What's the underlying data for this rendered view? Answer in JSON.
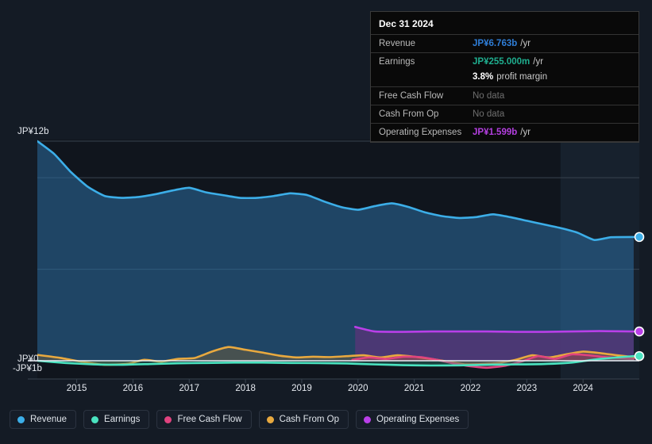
{
  "background_color": "#141b25",
  "tooltip": {
    "title": "Dec 31 2024",
    "rows": [
      {
        "label": "Revenue",
        "value": "JP¥6.763b",
        "unit": "/yr",
        "color": "#2f7ed8",
        "nodata": false
      },
      {
        "label": "Earnings",
        "value": "JP¥255.000m",
        "unit": "/yr",
        "color": "#1fae8f",
        "nodata": false
      },
      {
        "label": "",
        "value": "3.8%",
        "unit": "profit margin",
        "color": "#ffffff",
        "nodata": false,
        "sub": true
      },
      {
        "label": "Free Cash Flow",
        "value": "No data",
        "unit": "",
        "color": "#6f6f6f",
        "nodata": true
      },
      {
        "label": "Cash From Op",
        "value": "No data",
        "unit": "",
        "color": "#6f6f6f",
        "nodata": true
      },
      {
        "label": "Operating Expenses",
        "value": "JP¥1.599b",
        "unit": "/yr",
        "color": "#b43fe0",
        "nodata": false
      }
    ]
  },
  "legend": {
    "items": [
      {
        "label": "Revenue",
        "color": "#3caee8"
      },
      {
        "label": "Earnings",
        "color": "#4ae3c0"
      },
      {
        "label": "Free Cash Flow",
        "color": "#e0437f"
      },
      {
        "label": "Cash From Op",
        "color": "#e8a93f"
      },
      {
        "label": "Operating Expenses",
        "color": "#b93fe8"
      }
    ]
  },
  "chart_data": {
    "type": "area",
    "title": "",
    "xlabel": "",
    "ylabel": "",
    "currency": "JP¥",
    "grid": true,
    "legend_position": "bottom-left",
    "ylim": [
      -1,
      12
    ],
    "y_ticks": [
      {
        "value": 12,
        "label": "JP¥12b"
      },
      {
        "value": 0,
        "label": "JP¥0"
      },
      {
        "value": -1,
        "label": "-JP¥1b"
      }
    ],
    "x_ticks": [
      "2015",
      "2016",
      "2017",
      "2018",
      "2019",
      "2020",
      "2021",
      "2022",
      "2023",
      "2024"
    ],
    "xlim": [
      "2014.3",
      "2025.0"
    ],
    "forecast_band_start": "2023.6",
    "series": [
      {
        "name": "Revenue",
        "color": "#3caee8",
        "fill": "rgba(44,110,160,0.55)",
        "x": [
          2014.3,
          2014.6,
          2014.9,
          2015.2,
          2015.5,
          2015.8,
          2016.1,
          2016.4,
          2016.7,
          2017.0,
          2017.3,
          2017.6,
          2017.9,
          2018.2,
          2018.5,
          2018.8,
          2019.1,
          2019.4,
          2019.7,
          2020.0,
          2020.3,
          2020.6,
          2020.9,
          2021.2,
          2021.5,
          2021.8,
          2022.1,
          2022.4,
          2022.7,
          2023.0,
          2023.3,
          2023.6,
          2023.9,
          2024.2,
          2024.5,
          2024.9
        ],
        "values": [
          12.0,
          11.3,
          10.3,
          9.5,
          9.0,
          8.9,
          8.95,
          9.1,
          9.3,
          9.45,
          9.2,
          9.05,
          8.9,
          8.9,
          9.0,
          9.15,
          9.05,
          8.7,
          8.4,
          8.25,
          8.45,
          8.6,
          8.4,
          8.1,
          7.9,
          7.8,
          7.85,
          8.0,
          7.85,
          7.65,
          7.45,
          7.25,
          7.0,
          6.6,
          6.75,
          6.763
        ]
      },
      {
        "name": "Earnings",
        "color": "#4ae3c0",
        "fill": "rgba(50,150,130,0.35)",
        "x": [
          2014.3,
          2014.8,
          2015.3,
          2015.8,
          2016.3,
          2016.8,
          2017.3,
          2017.8,
          2018.3,
          2018.8,
          2019.3,
          2019.8,
          2020.3,
          2020.8,
          2021.3,
          2021.8,
          2022.3,
          2022.8,
          2023.3,
          2023.8,
          2024.3,
          2024.9
        ],
        "values": [
          0.0,
          -0.12,
          -0.2,
          -0.22,
          -0.18,
          -0.14,
          -0.12,
          -0.1,
          -0.1,
          -0.12,
          -0.13,
          -0.15,
          -0.2,
          -0.24,
          -0.26,
          -0.25,
          -0.22,
          -0.2,
          -0.18,
          -0.1,
          0.1,
          0.255
        ]
      },
      {
        "name": "Free Cash Flow",
        "color": "#e0437f",
        "fill": "rgba(180,50,100,0.30)",
        "x": [
          2019.9,
          2020.2,
          2020.5,
          2020.8,
          2021.1,
          2021.4,
          2021.7,
          2022.0,
          2022.3,
          2022.6,
          2022.9,
          2023.2,
          2023.5,
          2023.8,
          2024.1,
          2024.4,
          2024.9
        ],
        "values": [
          0.05,
          0.18,
          0.1,
          0.22,
          0.2,
          0.05,
          -0.15,
          -0.3,
          -0.38,
          -0.28,
          -0.05,
          0.25,
          0.1,
          0.35,
          0.3,
          0.2,
          0.1
        ]
      },
      {
        "name": "Cash From Op",
        "color": "#e8a93f",
        "fill": "rgba(120,95,55,0.45)",
        "x": [
          2014.3,
          2014.7,
          2015.1,
          2015.5,
          2015.9,
          2016.2,
          2016.5,
          2016.8,
          2017.1,
          2017.4,
          2017.7,
          2018.0,
          2018.3,
          2018.6,
          2018.9,
          2019.2,
          2019.5,
          2019.8,
          2020.1,
          2020.4,
          2020.7,
          2021.0,
          2021.3,
          2021.6,
          2021.9,
          2022.2,
          2022.5,
          2022.8,
          2023.1,
          2023.4,
          2023.7,
          2024.0,
          2024.3,
          2024.6,
          2024.9
        ],
        "values": [
          0.32,
          0.16,
          -0.06,
          -0.22,
          -0.17,
          0.05,
          -0.05,
          0.1,
          0.15,
          0.5,
          0.75,
          0.6,
          0.45,
          0.28,
          0.18,
          0.22,
          0.2,
          0.25,
          0.3,
          0.18,
          0.3,
          0.22,
          0.1,
          -0.05,
          -0.2,
          -0.18,
          -0.12,
          0.05,
          0.3,
          0.18,
          0.35,
          0.5,
          0.42,
          0.3,
          0.2
        ]
      },
      {
        "name": "Operating Expenses",
        "color": "#b93fe8",
        "fill": "rgba(86,52,120,0.80)",
        "x": [
          2019.95,
          2020.3,
          2020.8,
          2021.3,
          2021.8,
          2022.3,
          2022.8,
          2023.3,
          2023.8,
          2024.3,
          2024.9
        ],
        "values": [
          1.85,
          1.6,
          1.58,
          1.6,
          1.6,
          1.6,
          1.58,
          1.58,
          1.6,
          1.62,
          1.599
        ]
      }
    ],
    "endpoints": [
      {
        "name": "Revenue",
        "color": "#3caee8",
        "value": 6.763
      },
      {
        "name": "Operating Expenses",
        "color": "#b93fe8",
        "value": 1.599
      },
      {
        "name": "Earnings",
        "color": "#4ae3c0",
        "value": 0.255
      }
    ]
  }
}
